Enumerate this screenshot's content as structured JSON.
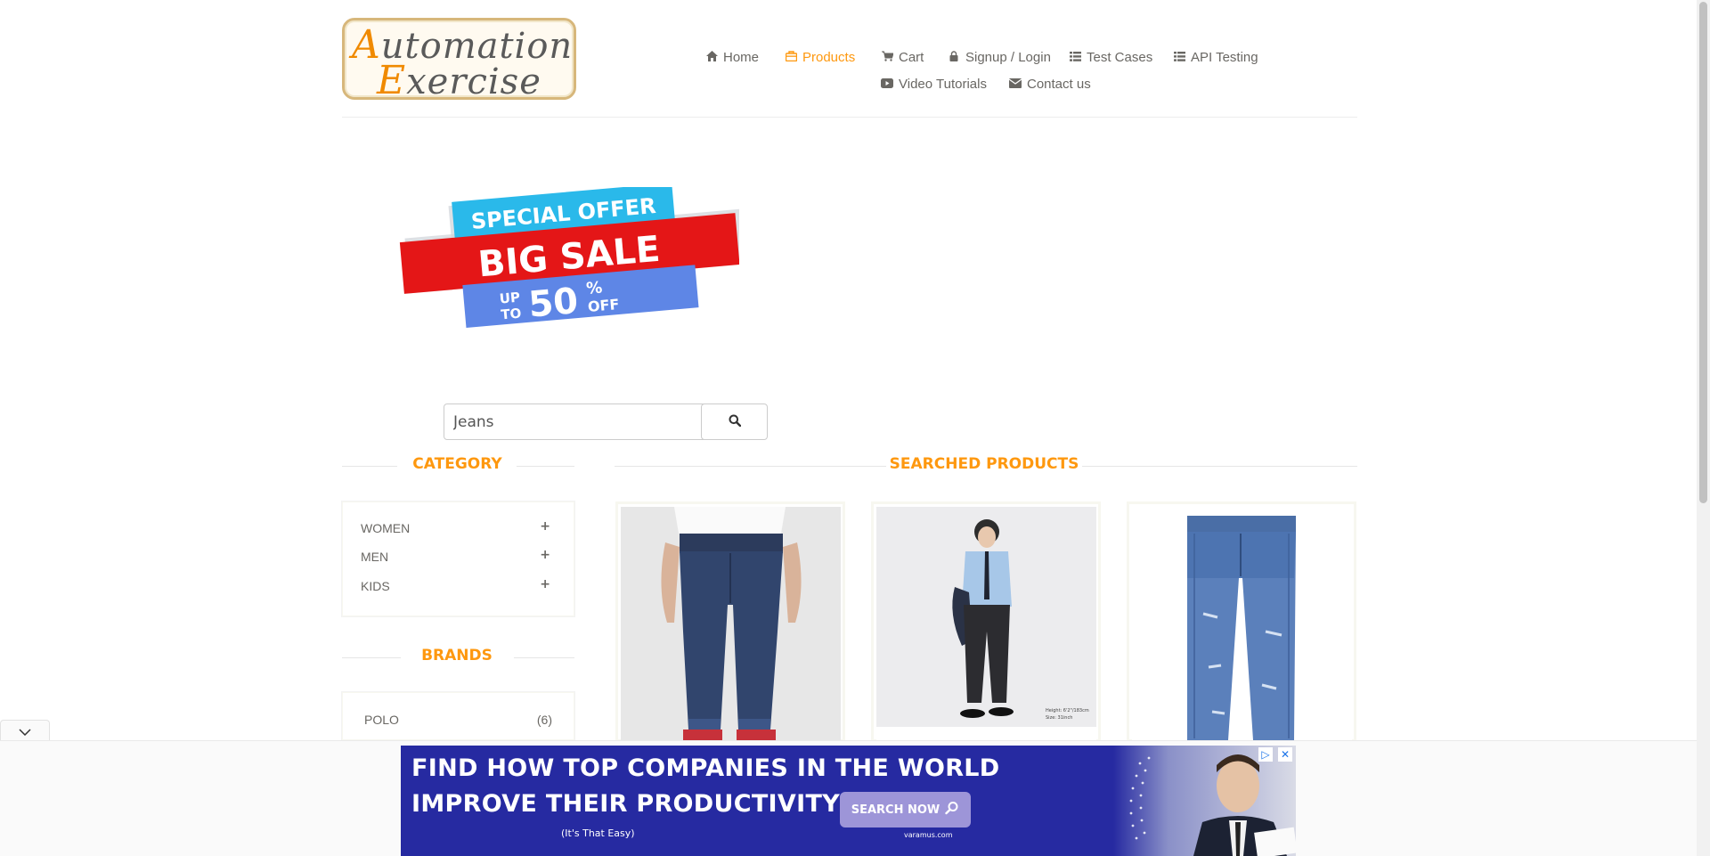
{
  "logo": {
    "line1_cap": "A",
    "line1_rest": "utomation",
    "line2_cap": "E",
    "line2_rest": "xercise"
  },
  "nav": [
    {
      "label": "Home",
      "icon": "home-icon",
      "active": false
    },
    {
      "label": "Products",
      "icon": "shopping-bag-icon",
      "active": true
    },
    {
      "label": "Cart",
      "icon": "cart-icon",
      "active": false
    },
    {
      "label": "Signup / Login",
      "icon": "lock-icon",
      "active": false
    },
    {
      "label": "Test Cases",
      "icon": "list-icon",
      "active": false
    },
    {
      "label": "API Testing",
      "icon": "list-icon",
      "active": false
    },
    {
      "label": "Video Tutorials",
      "icon": "youtube-play-icon",
      "active": false
    },
    {
      "label": "Contact us",
      "icon": "envelope-icon",
      "active": false
    }
  ],
  "banner": {
    "line1": "SPECIAL OFFER",
    "line2": "BIG SALE",
    "up": "UP",
    "to": "TO",
    "percent": "50",
    "pct_sign": "%",
    "off": "OFF"
  },
  "search": {
    "value": "Jeans"
  },
  "category": {
    "title": "CATEGORY",
    "items": [
      {
        "label": "WOMEN"
      },
      {
        "label": "MEN"
      },
      {
        "label": "KIDS"
      }
    ]
  },
  "brands": {
    "title": "BRANDS",
    "items": [
      {
        "label": "POLO",
        "count": "(6)"
      }
    ]
  },
  "products": {
    "title": "SEARCHED PRODUCTS"
  },
  "ad": {
    "line1": "FIND HOW TOP COMPANIES IN THE WORLD",
    "line2": "IMPROVE THEIR PRODUCTIVITY",
    "cta": "SEARCH NOW",
    "small": "(It's That Easy)",
    "brand": "varamus.com"
  },
  "colors": {
    "accent": "#fe980f",
    "text": "#696763",
    "ad_bg": "#262aa1"
  }
}
